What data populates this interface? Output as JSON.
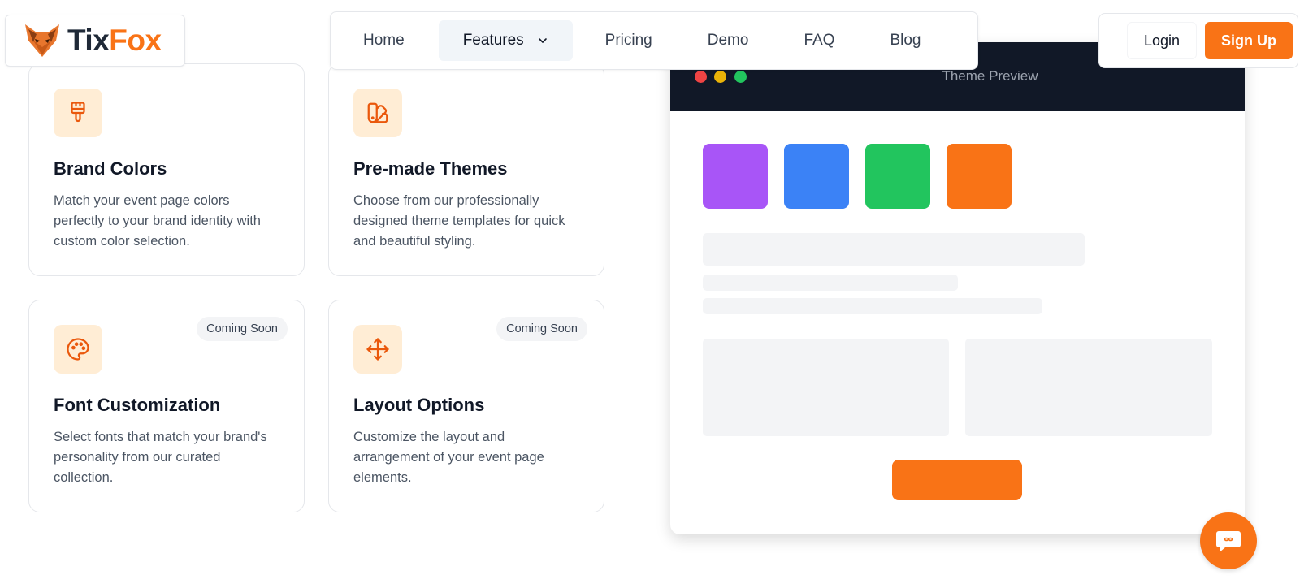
{
  "brand": {
    "name_part1": "Tix",
    "name_part2": "Fox",
    "accent": "#f97316",
    "dark": "#111827"
  },
  "nav": {
    "items": [
      {
        "label": "Home"
      },
      {
        "label": "Features",
        "active": true
      },
      {
        "label": "Pricing"
      },
      {
        "label": "Demo"
      },
      {
        "label": "FAQ"
      },
      {
        "label": "Blog"
      }
    ]
  },
  "auth": {
    "login_label": "Login",
    "signup_label": "Sign Up"
  },
  "features": [
    {
      "icon": "paintbrush-icon",
      "title": "Brand Colors",
      "description": "Match your event page colors perfectly to your brand identity with custom color selection.",
      "badge": ""
    },
    {
      "icon": "swatchbook-icon",
      "title": "Pre-made Themes",
      "description": "Choose from our professionally designed theme templates for quick and beautiful styling.",
      "badge": ""
    },
    {
      "icon": "palette-icon",
      "title": "Font Customization",
      "description": "Select fonts that match your brand's personality from our curated collection.",
      "badge": "Coming Soon"
    },
    {
      "icon": "move-icon",
      "title": "Layout Options",
      "description": "Customize the layout and arrangement of your event page elements.",
      "badge": "Coming Soon"
    }
  ],
  "preview": {
    "title": "Theme Preview",
    "window_dots": [
      "#ef4444",
      "#eab308",
      "#22c55e"
    ],
    "swatches": [
      "#a855f7",
      "#3b82f6",
      "#22c55e",
      "#f97316"
    ]
  },
  "chat": {
    "icon": "chat-icon"
  }
}
